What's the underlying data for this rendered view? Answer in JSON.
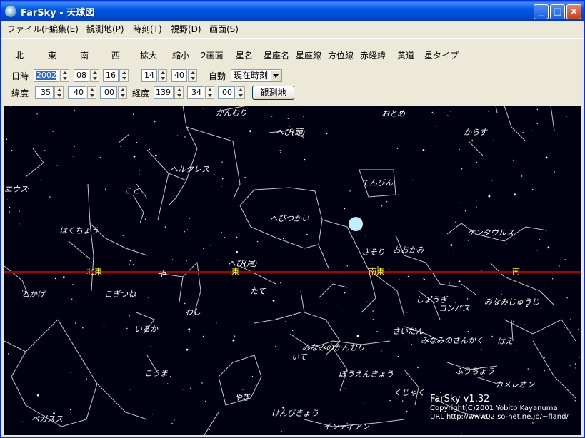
{
  "window": {
    "title": "FarSky - 天球図",
    "minimize": "_",
    "maximize": "□",
    "close": "×"
  },
  "menu": [
    "ファイル(F)",
    "編集(E)",
    "観測地(P)",
    "時刻(T)",
    "視野(D)",
    "画面(S)"
  ],
  "toolbar": [
    "北",
    "東",
    "南",
    "西",
    "拡大",
    "縮小",
    "2画面",
    "星名",
    "星座名",
    "星座線",
    "方位線",
    "赤経緯",
    "黄道",
    "星タイプ"
  ],
  "datetime": {
    "label": "日時",
    "year": "2002",
    "month": "08",
    "day": "16",
    "hour": "14",
    "minute": "40",
    "auto_label": "自動",
    "auto_value": "現在時刻"
  },
  "location": {
    "lat_label": "緯度",
    "lat_deg": "35",
    "lat_min": "40",
    "lat_sec": "00",
    "lon_label": "経度",
    "lon_deg": "139",
    "lon_min": "34",
    "lon_sec": "00",
    "button": "観測地"
  },
  "sky": {
    "horizon_color": "#aa0000",
    "directions": [
      "北東",
      "東",
      "南東",
      "南"
    ],
    "constellations": [
      "かんむり",
      "おとめ",
      "へび(頭)",
      "からす",
      "ヘルクレス",
      "てんびん",
      "エウス",
      "こと",
      "へびつかい",
      "はくちょう",
      "ケンタウルス",
      "おおかみ",
      "さそり",
      "へび(尾)",
      "や",
      "とかげ",
      "こぎつね",
      "たて",
      "しょうぎ",
      "コンパス",
      "みなみじゅうじ",
      "わし",
      "いるか",
      "さいだん",
      "みなみのさんかく",
      "はえ",
      "みなみのかんむり",
      "いて",
      "こうま",
      "ぼうえんきょう",
      "ふうちょう",
      "カメレオン",
      "やぎ",
      "くじゃく",
      "ペガスス",
      "けんびきょう",
      "インディアン"
    ]
  },
  "credit": {
    "version": "FarSky v1.32",
    "copyright": "Copyright(C)2001 Yobito Kayanuma",
    "url": "URL http://www02.so-net.ne.jp/~fland/"
  }
}
